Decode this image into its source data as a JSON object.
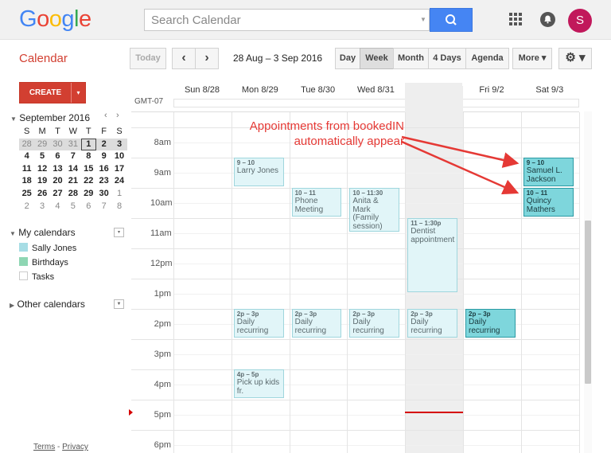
{
  "header": {
    "logo": {
      "text": "Google",
      "letters": [
        "G",
        "o",
        "o",
        "g",
        "l",
        "e"
      ],
      "colors": [
        "#4285f4",
        "#ea4335",
        "#fbbc05",
        "#4285f4",
        "#34a853",
        "#ea4335"
      ]
    },
    "search_placeholder": "Search Calendar",
    "avatar_initial": "S",
    "icons": {
      "search": "search-icon",
      "apps": "apps-grid-icon",
      "notifications": "bell-icon"
    }
  },
  "toolbar": {
    "title": "Calendar",
    "today_label": "Today",
    "prev_glyph": "‹",
    "next_glyph": "›",
    "date_range": "28 Aug – 3 Sep 2016",
    "views": {
      "day": "Day",
      "week": "Week",
      "month": "Month",
      "four_days": "4 Days",
      "agenda": "Agenda"
    },
    "selected_view": "Week",
    "more_label": "More ▾",
    "settings_glyph": "⚙ ▾"
  },
  "sidebar": {
    "create_label": "CREATE",
    "create_arrow": "▾",
    "mini_cal": {
      "month_label": "September 2016",
      "toggle": "◂",
      "prev": "‹",
      "next": "›",
      "weekday_initials": [
        "S",
        "M",
        "T",
        "W",
        "T",
        "F",
        "S"
      ],
      "weeks": [
        [
          "28",
          "29",
          "30",
          "31",
          "1",
          "2",
          "3"
        ],
        [
          "4",
          "5",
          "6",
          "7",
          "8",
          "9",
          "10"
        ],
        [
          "11",
          "12",
          "13",
          "14",
          "15",
          "16",
          "17"
        ],
        [
          "18",
          "19",
          "20",
          "21",
          "22",
          "23",
          "24"
        ],
        [
          "25",
          "26",
          "27",
          "28",
          "29",
          "30",
          "1"
        ],
        [
          "2",
          "3",
          "4",
          "5",
          "6",
          "7",
          "8"
        ]
      ],
      "today": "1"
    },
    "my_calendars": {
      "label": "My calendars",
      "toggle": "▾",
      "items": [
        {
          "label": "Sally Jones",
          "color": "#a7dde5"
        },
        {
          "label": "Birthdays",
          "color": "#8ed6b3"
        },
        {
          "label": "Tasks",
          "color": "#ffffff"
        }
      ]
    },
    "other_calendars": {
      "label": "Other calendars",
      "toggle": "▸"
    },
    "footer": {
      "terms": "Terms",
      "separator": " - ",
      "privacy": "Privacy"
    }
  },
  "grid": {
    "timezone": "GMT-07",
    "days": [
      "Sun 8/28",
      "Mon 8/29",
      "Tue 8/30",
      "Wed 8/31",
      "Thu 9/1",
      "Fri 9/2",
      "Sat 9/3"
    ],
    "today_index": 4,
    "hours": [
      "8am",
      "9am",
      "10am",
      "11am",
      "12pm",
      "1pm",
      "2pm",
      "3pm",
      "4pm",
      "5pm",
      "6pm"
    ],
    "start_hour": 7.5,
    "now_hour": 17.4,
    "events": [
      {
        "day": 1,
        "start": 9.0,
        "end": 10.0,
        "time": "9 – 10",
        "title": "Larry Jones",
        "strong": false
      },
      {
        "day": 2,
        "start": 10.0,
        "end": 11.0,
        "time": "10 – 11",
        "title": "Phone Meeting",
        "strong": false
      },
      {
        "day": 3,
        "start": 10.0,
        "end": 11.5,
        "time": "10 – 11:30",
        "title": "Anita & Mark (Family session)",
        "strong": false
      },
      {
        "day": 4,
        "start": 11.0,
        "end": 13.5,
        "time": "11 – 1:30p",
        "title": "Dentist appointment",
        "strong": false
      },
      {
        "day": 6,
        "start": 9.0,
        "end": 10.0,
        "time": "9 – 10",
        "title": "Samuel L. Jackson",
        "strong": true
      },
      {
        "day": 6,
        "start": 10.0,
        "end": 11.0,
        "time": "10 – 11",
        "title": "Quincy Mathers",
        "strong": true
      },
      {
        "day": 1,
        "start": 14.0,
        "end": 15.0,
        "time": "2p – 3p",
        "title": "Daily recurring",
        "strong": false
      },
      {
        "day": 2,
        "start": 14.0,
        "end": 15.0,
        "time": "2p – 3p",
        "title": "Daily recurring",
        "strong": false
      },
      {
        "day": 3,
        "start": 14.0,
        "end": 15.0,
        "time": "2p – 3p",
        "title": "Daily recurring",
        "strong": false
      },
      {
        "day": 4,
        "start": 14.0,
        "end": 15.0,
        "time": "2p – 3p",
        "title": "Daily recurring",
        "strong": false
      },
      {
        "day": 5,
        "start": 14.0,
        "end": 15.0,
        "time": "2p – 3p",
        "title": "Daily recurring",
        "strong": true
      },
      {
        "day": 1,
        "start": 16.0,
        "end": 17.0,
        "time": "4p – 5p",
        "title": "Pick up kids fr.",
        "strong": false
      }
    ]
  },
  "annotation": {
    "line1": "Appointments from bookedIN",
    "line2": "automatically appear",
    "color": "#e53935"
  }
}
